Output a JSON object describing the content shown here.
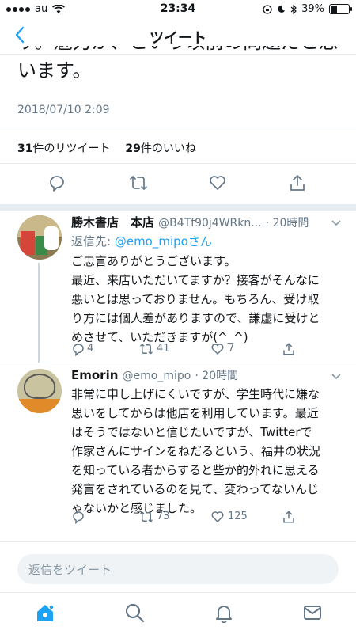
{
  "status": {
    "carrier": "au",
    "time": "23:34",
    "battery": "39%"
  },
  "nav": {
    "title": "ツイート"
  },
  "tweet": {
    "body_partial": "す。魅力が、という以前の問題だと思",
    "body_end": "います。",
    "date": "2018/07/10 2:09",
    "retweets": "31",
    "retweets_label": "件のリツイート",
    "likes": "29",
    "likes_label": "件のいいね"
  },
  "replies": [
    {
      "name": "勝木書店　本店",
      "handle": "@B4Tf90j4WRkn...",
      "time": "· 20時間",
      "reply_to_label": "返信先:",
      "reply_to": "@emo_mipoさん",
      "lines": [
        "ご忠言ありがとうございます。",
        "最近、来店いただいてますか？接客がそんなに",
        "悪いとは思っておりません。もちろん、受け取",
        "り方には個人差がありますので、謙虚に受けと",
        "めさせて、いただきますが(^_^)"
      ],
      "replies_count": "4",
      "retweets_count": "41",
      "likes_count": "7"
    },
    {
      "name": "Emorin",
      "handle": "@emo_mipo",
      "time": "· 20時間",
      "lines": [
        "非常に申し上げにくいですが、学生時代に嫌な",
        "思いをしてからは他店を利用しています。最近",
        "はそうではないと信じたいですが、Twitterで",
        "作家さんにサインをねだるという、福井の状況",
        "を知っている者からすると些か的外れに思える",
        "発言をされているのを見て、変わってないんじ",
        "ゃないかと感じました。"
      ],
      "replies_count": "",
      "retweets_count": "73",
      "likes_count": "125"
    }
  ],
  "composer": {
    "placeholder": "返信をツイート"
  },
  "colors": {
    "accent": "#1da1f2",
    "muted": "#657786",
    "divider": "#e6ecf0"
  }
}
